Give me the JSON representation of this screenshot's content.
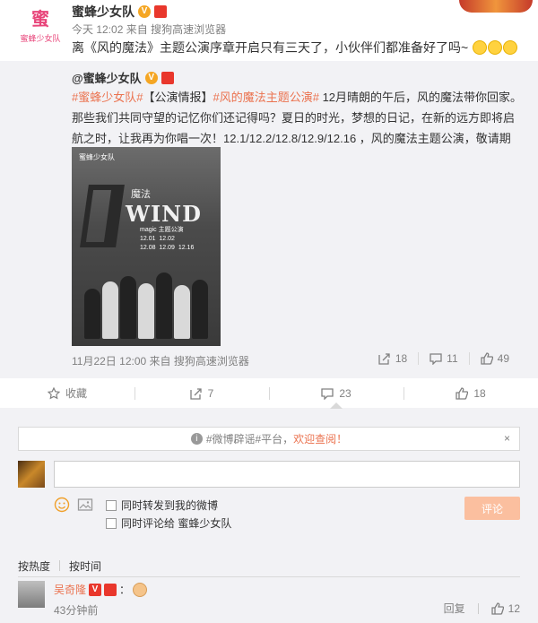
{
  "post": {
    "avatar_text": "蜜蜂少女队",
    "author": "蜜蜂少女队",
    "time": "今天 12:02",
    "via_prefix": "来自",
    "via": "搜狗高速浏览器",
    "text": "离《风的魔法》主题公演序章开启只有三天了，小伙伴们都准备好了吗~"
  },
  "repost": {
    "author": "@蜜蜂少女队",
    "tag1": "#蜜蜂少女队#",
    "tag2": "【公演情报】",
    "tag3": "#风的魔法主题公演#",
    "body": " 12月晴朗的午后，风的魔法带你回家。那些我们共同守望的记忆你们还记得吗？夏日的时光，梦想的日记，在新的远方即将启航之时，让我再为你唱一次！12.1/12.2/12.8/12.9/12.16 ，风的魔法主题公演，敬请期待。",
    "poster": {
      "top_line": "蜜蜂少女队",
      "title_cn": "魔法",
      "title_en": "WIND",
      "sub": "magic 主题公演",
      "dates": "12.01  12.02\n12.08  12.09  12.16"
    },
    "time": "11月22日 12:00",
    "via_prefix": "来自",
    "via": "搜狗高速浏览器",
    "share_count": "18",
    "comment_count": "11",
    "like_count": "49"
  },
  "actions": {
    "favorite": "收藏",
    "share": "7",
    "comment": "23",
    "like": "18"
  },
  "comment_box": {
    "notice_prefix": "#微博辟谣#平台，",
    "notice_link": "欢迎查阅！",
    "notice_close": "×",
    "forward_label": "同时转发到我的微博",
    "comment_to_label": "同时评论给 蜜蜂少女队",
    "submit": "评论"
  },
  "sort": {
    "by_hot": "按热度",
    "by_time": "按时间"
  },
  "comments": [
    {
      "name": "吴奇隆",
      "sep": "：",
      "time": "43分钟前",
      "reply": "回复",
      "likes": "12"
    }
  ],
  "colors": {
    "accent": "#eb7350",
    "bg_gray": "#f2f2f5",
    "submit_disabled": "#fbbf9f"
  }
}
